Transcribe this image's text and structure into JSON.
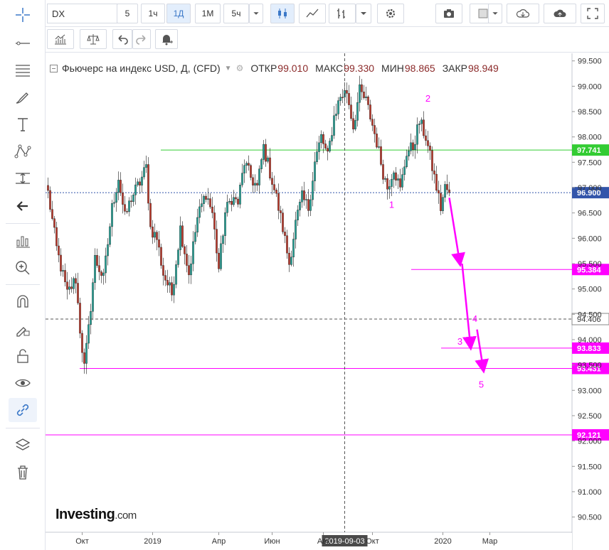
{
  "toolbar": {
    "symbol": "DX",
    "timeframes": [
      "5",
      "1ч",
      "1Д",
      "1М",
      "5ч"
    ],
    "active_timeframe": "1Д"
  },
  "legend": {
    "title": "Фьючерс на индекс USD, Д, (CFD)",
    "open_label": "ОТКР",
    "open_value": "99.010",
    "high_label": "МАКС",
    "high_value": "99.330",
    "low_label": "МИН",
    "low_value": "98.865",
    "close_label": "ЗАКР",
    "close_value": "98.949"
  },
  "logo": {
    "brand": "Investing",
    "domain": ".com"
  },
  "colors": {
    "up": "#26a69a",
    "down": "#c0392b",
    "magenta": "#ff00ff",
    "green_level": "#33cc33",
    "blue_price": "#3355aa"
  },
  "chart_data": {
    "type": "candlestick",
    "ylim": [
      90.2,
      99.65
    ],
    "y_ticks": [
      "90.500",
      "91.000",
      "91.500",
      "92.000",
      "92.500",
      "93.000",
      "93.500",
      "94.000",
      "94.500",
      "95.000",
      "95.500",
      "96.000",
      "96.500",
      "97.000",
      "97.500",
      "98.000",
      "98.500",
      "99.000",
      "99.500"
    ],
    "x_ticks": [
      {
        "label": "Окт",
        "i": 16
      },
      {
        "label": "2019",
        "i": 49
      },
      {
        "label": "Апр",
        "i": 80
      },
      {
        "label": "Июн",
        "i": 105
      },
      {
        "label": "Авг",
        "i": 129
      },
      {
        "label": "Окт",
        "i": 152
      },
      {
        "label": "2020",
        "i": 185
      },
      {
        "label": "Мар",
        "i": 207
      }
    ],
    "crosshair": {
      "date": "2019-09-03",
      "i": 139,
      "price": "94.406"
    },
    "levels": [
      {
        "price": 97.741,
        "label": "97.741",
        "color": "green"
      },
      {
        "price": 96.9,
        "label": "96.900",
        "color": "blue"
      },
      {
        "price": 95.384,
        "label": "95.384",
        "color": "magenta"
      },
      {
        "price": 93.833,
        "label": "93.833",
        "color": "magenta"
      },
      {
        "price": 93.431,
        "label": "93.431",
        "color": "magenta"
      },
      {
        "price": 92.121,
        "label": "92.121",
        "color": "magenta"
      }
    ],
    "wave_labels": [
      {
        "text": "1",
        "i": 161,
        "price": 96.6
      },
      {
        "text": "2",
        "i": 178,
        "price": 98.7
      },
      {
        "text": "3",
        "i": 193,
        "price": 93.9
      },
      {
        "text": "4",
        "i": 200,
        "price": 94.35
      },
      {
        "text": "5",
        "i": 203,
        "price": 93.05
      }
    ],
    "anchors": [
      [
        0,
        96.9
      ],
      [
        4,
        95.8
      ],
      [
        9,
        94.9
      ],
      [
        13,
        95.2
      ],
      [
        15,
        94.2
      ],
      [
        17,
        93.45
      ],
      [
        19,
        94.2
      ],
      [
        22,
        95.6
      ],
      [
        26,
        95.2
      ],
      [
        30,
        96.6
      ],
      [
        33,
        97.2
      ],
      [
        36,
        96.4
      ],
      [
        39,
        96.8
      ],
      [
        43,
        97.1
      ],
      [
        46,
        97.4
      ],
      [
        48,
        96.2
      ],
      [
        51,
        96.0
      ],
      [
        54,
        95.3
      ],
      [
        58,
        94.9
      ],
      [
        62,
        96.2
      ],
      [
        66,
        95.3
      ],
      [
        70,
        96.4
      ],
      [
        74,
        96.9
      ],
      [
        77,
        96.5
      ],
      [
        80,
        95.4
      ],
      [
        83,
        96.5
      ],
      [
        86,
        96.8
      ],
      [
        89,
        96.7
      ],
      [
        92,
        97.5
      ],
      [
        95,
        97.2
      ],
      [
        98,
        97.0
      ],
      [
        101,
        97.8
      ],
      [
        104,
        97.3
      ],
      [
        107,
        96.8
      ],
      [
        110,
        96.2
      ],
      [
        113,
        95.5
      ],
      [
        116,
        96.3
      ],
      [
        119,
        96.8
      ],
      [
        122,
        96.6
      ],
      [
        125,
        97.5
      ],
      [
        128,
        98.0
      ],
      [
        131,
        97.6
      ],
      [
        134,
        98.4
      ],
      [
        137,
        98.8
      ],
      [
        140,
        98.9
      ],
      [
        143,
        98.2
      ],
      [
        146,
        98.9
      ],
      [
        149,
        98.7
      ],
      [
        151,
        98.4
      ],
      [
        154,
        97.9
      ],
      [
        157,
        97.3
      ],
      [
        159,
        97.0
      ],
      [
        162,
        97.4
      ],
      [
        165,
        96.95
      ],
      [
        168,
        97.7
      ],
      [
        171,
        97.8
      ],
      [
        174,
        98.3
      ],
      [
        177,
        98.0
      ],
      [
        180,
        97.4
      ],
      [
        182,
        97.0
      ],
      [
        184,
        96.6
      ],
      [
        186,
        97.0
      ],
      [
        188,
        96.9
      ]
    ],
    "projection_arrows": [
      [
        [
          188,
          96.8
        ],
        [
          193,
          95.5
        ]
      ],
      [
        [
          194,
          95.5
        ],
        [
          198,
          93.85
        ]
      ],
      [
        [
          201,
          94.2
        ],
        [
          204,
          93.4
        ]
      ]
    ]
  }
}
